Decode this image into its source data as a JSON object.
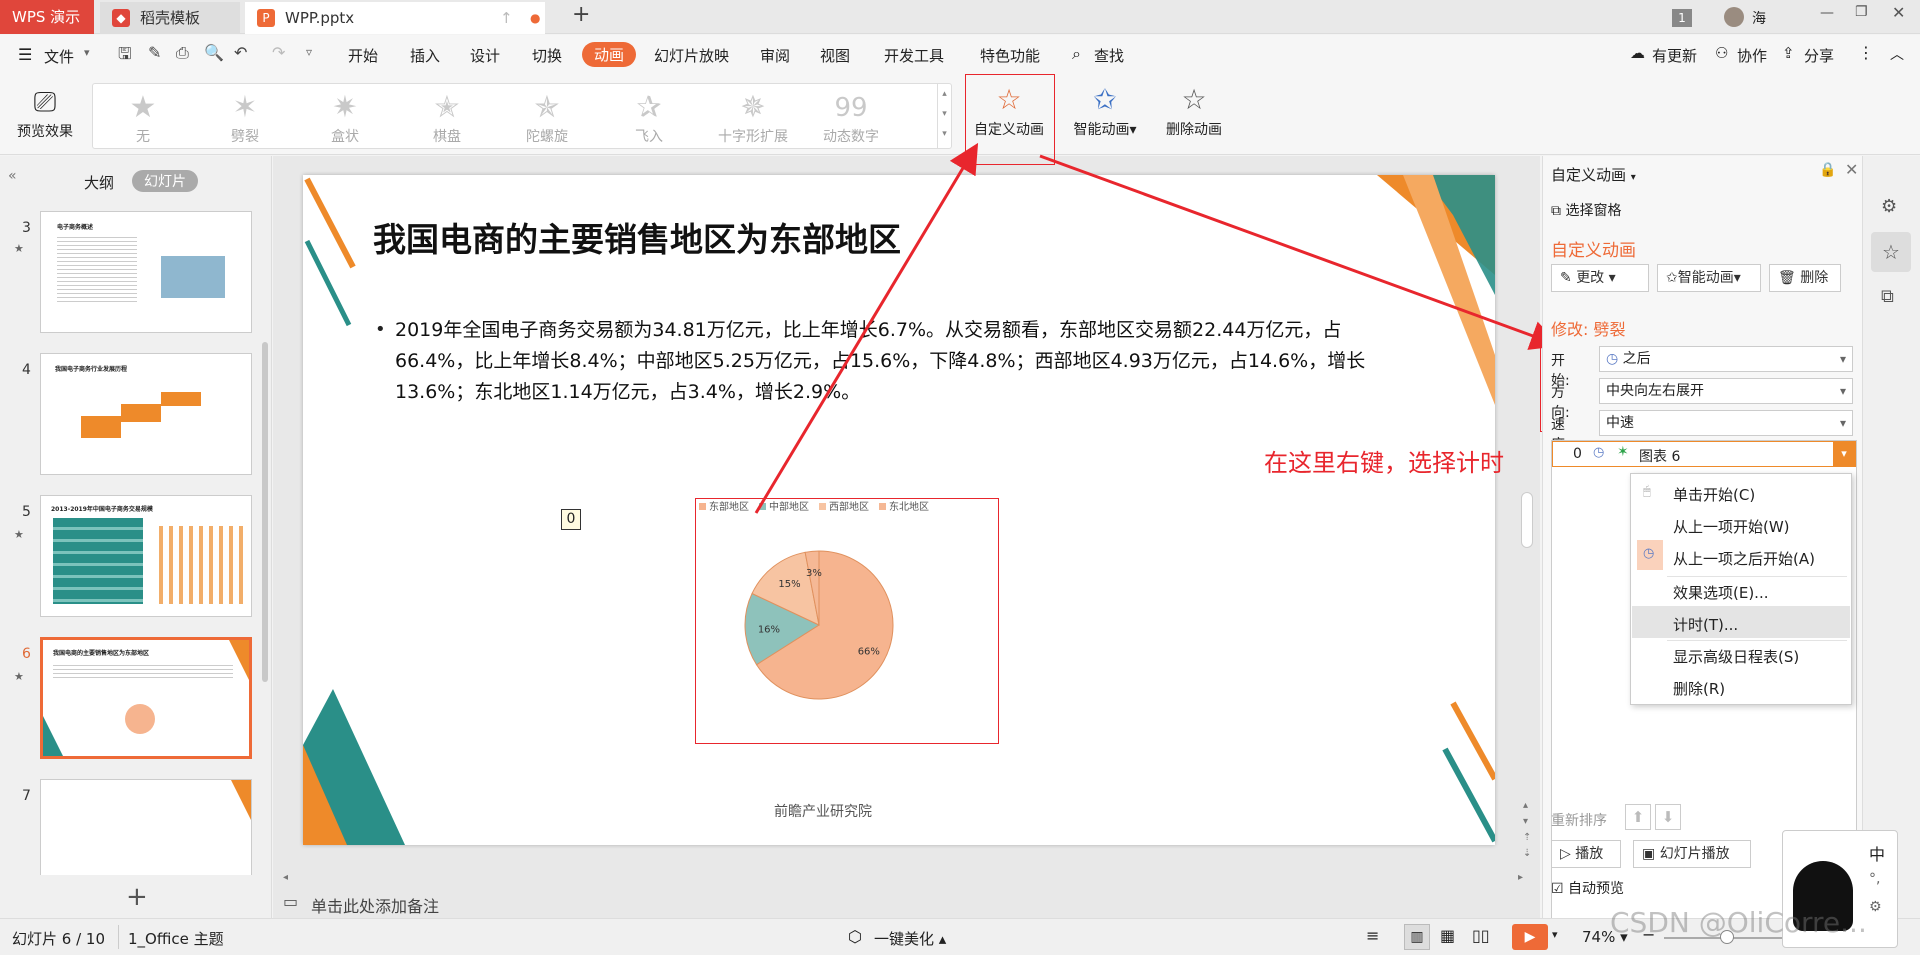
{
  "tabbar": {
    "app_tab": "WPS 演示",
    "doc_tabs": [
      {
        "label": "稻壳模板"
      },
      {
        "label": "WPP.pptx"
      }
    ],
    "window_badge": "1",
    "user": "海"
  },
  "menubar": {
    "file": "文件",
    "items": [
      "开始",
      "插入",
      "设计",
      "切换",
      "动画",
      "幻灯片放映",
      "审阅",
      "视图",
      "开发工具",
      "特色功能"
    ],
    "active": "动画",
    "search": "查找",
    "right": [
      "有更新",
      "协作",
      "分享"
    ]
  },
  "ribbon": {
    "preview": "预览效果",
    "effects": [
      "无",
      "劈裂",
      "盒状",
      "棋盘",
      "陀螺旋",
      "飞入",
      "十字形扩展",
      "动态数字"
    ],
    "custom_anim": "自定义动画",
    "smart_anim": "智能动画",
    "delete_anim": "删除动画"
  },
  "leftpanel": {
    "tab_outline": "大纲",
    "tab_slides": "幻灯片",
    "slides": [
      {
        "num": "3",
        "title": "电子商务概述"
      },
      {
        "num": "4",
        "title": "我国电子商务行业发展历程"
      },
      {
        "num": "5",
        "title": "2013-2019年中国电子商务交易规模"
      },
      {
        "num": "6",
        "title": "我国电商的主要销售地区为东部地区"
      },
      {
        "num": "7",
        "title": ""
      }
    ]
  },
  "slide": {
    "title": "我国电商的主要销售地区为东部地区",
    "bullet": "2019年全国电子商务交易额为34.81万亿元，比上年增长6.7%。从交易额看，东部地区交易额22.44万亿元，占66.4%，比上年增长8.4%；中部地区5.25万亿元，占15.6%，下降4.8%；西部地区4.93万亿元，占14.6%，增长13.6%；东北地区1.14万亿元，占3.4%，增长2.9%。",
    "anim_tag": "0",
    "source": "前瞻产业研究院"
  },
  "chart_data": {
    "type": "pie",
    "categories": [
      "东部地区",
      "中部地区",
      "西部地区",
      "东北地区"
    ],
    "values": [
      66,
      16,
      15,
      3
    ],
    "labels": [
      "66%",
      "16%",
      "15%",
      "3%"
    ],
    "colors": [
      "#f6b48f",
      "#8ec2bb",
      "#f7c4a2",
      "#f5b895"
    ],
    "legend": "top"
  },
  "annotation": "在这里右键，选择计时",
  "notes_placeholder": "单击此处添加备注",
  "rightpanel": {
    "header": "自定义动画",
    "select_pane": "选择窗格",
    "section": "自定义动画",
    "btn_change": "更改",
    "btn_smart": "智能动画",
    "btn_delete": "删除",
    "modify_label": "修改: 劈裂",
    "start_label": "开始:",
    "start_value": "之后",
    "dir_label": "方向:",
    "dir_value": "中央向左右展开",
    "speed_label": "速度:",
    "speed_value": "中速",
    "list_item_num": "0",
    "list_item_name": "图表 6",
    "reorder": "重新排序",
    "play": "播放",
    "slideshow": "幻灯片播放",
    "autopreview": "自动预览"
  },
  "contextmenu": [
    "单击开始(C)",
    "从上一项开始(W)",
    "从上一项之后开始(A)",
    "效果选项(E)...",
    "计时(T)...",
    "显示高级日程表(S)",
    "删除(R)"
  ],
  "statusbar": {
    "slide_info": "幻灯片 6 / 10",
    "theme": "1_Office 主题",
    "beautify": "一键美化",
    "zoom": "74%",
    "ime": "中"
  },
  "watermark": "CSDN @OliCorre..."
}
